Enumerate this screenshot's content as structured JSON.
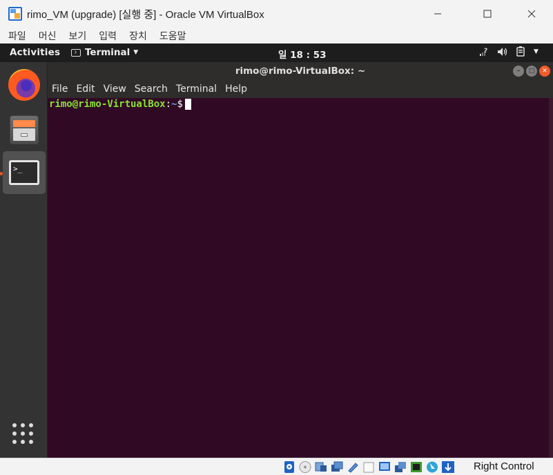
{
  "window": {
    "title": "rimo_VM (upgrade) [실행 중] - Oracle VM VirtualBox"
  },
  "vbox_menu": {
    "items": [
      "파일",
      "머신",
      "보기",
      "입력",
      "장치",
      "도움말"
    ]
  },
  "gnome_topbar": {
    "activities": "Activities",
    "app_menu": "Terminal",
    "clock": "일 18 : 53"
  },
  "dock": {
    "items": [
      {
        "name": "Firefox",
        "icon": "firefox-icon"
      },
      {
        "name": "Files",
        "icon": "files-icon"
      },
      {
        "name": "Terminal",
        "icon": "terminal-icon",
        "running": true,
        "term_glyph": ">_"
      }
    ],
    "show_apps_icon": "show-applications-grid-icon"
  },
  "terminal": {
    "title": "rimo@rimo-VirtualBox: ~",
    "menu": [
      "File",
      "Edit",
      "View",
      "Search",
      "Terminal",
      "Help"
    ],
    "prompt_user_host": "rimo@rimo-VirtualBox",
    "prompt_colon": ":",
    "prompt_path": "~",
    "prompt_symbol": "$"
  },
  "statusbar": {
    "host_key": "Right Control"
  },
  "colors": {
    "terminal_bg": "#300a24",
    "prompt_user": "#8ae234",
    "prompt_path": "#729fcf",
    "ubuntu_orange": "#e95420"
  }
}
